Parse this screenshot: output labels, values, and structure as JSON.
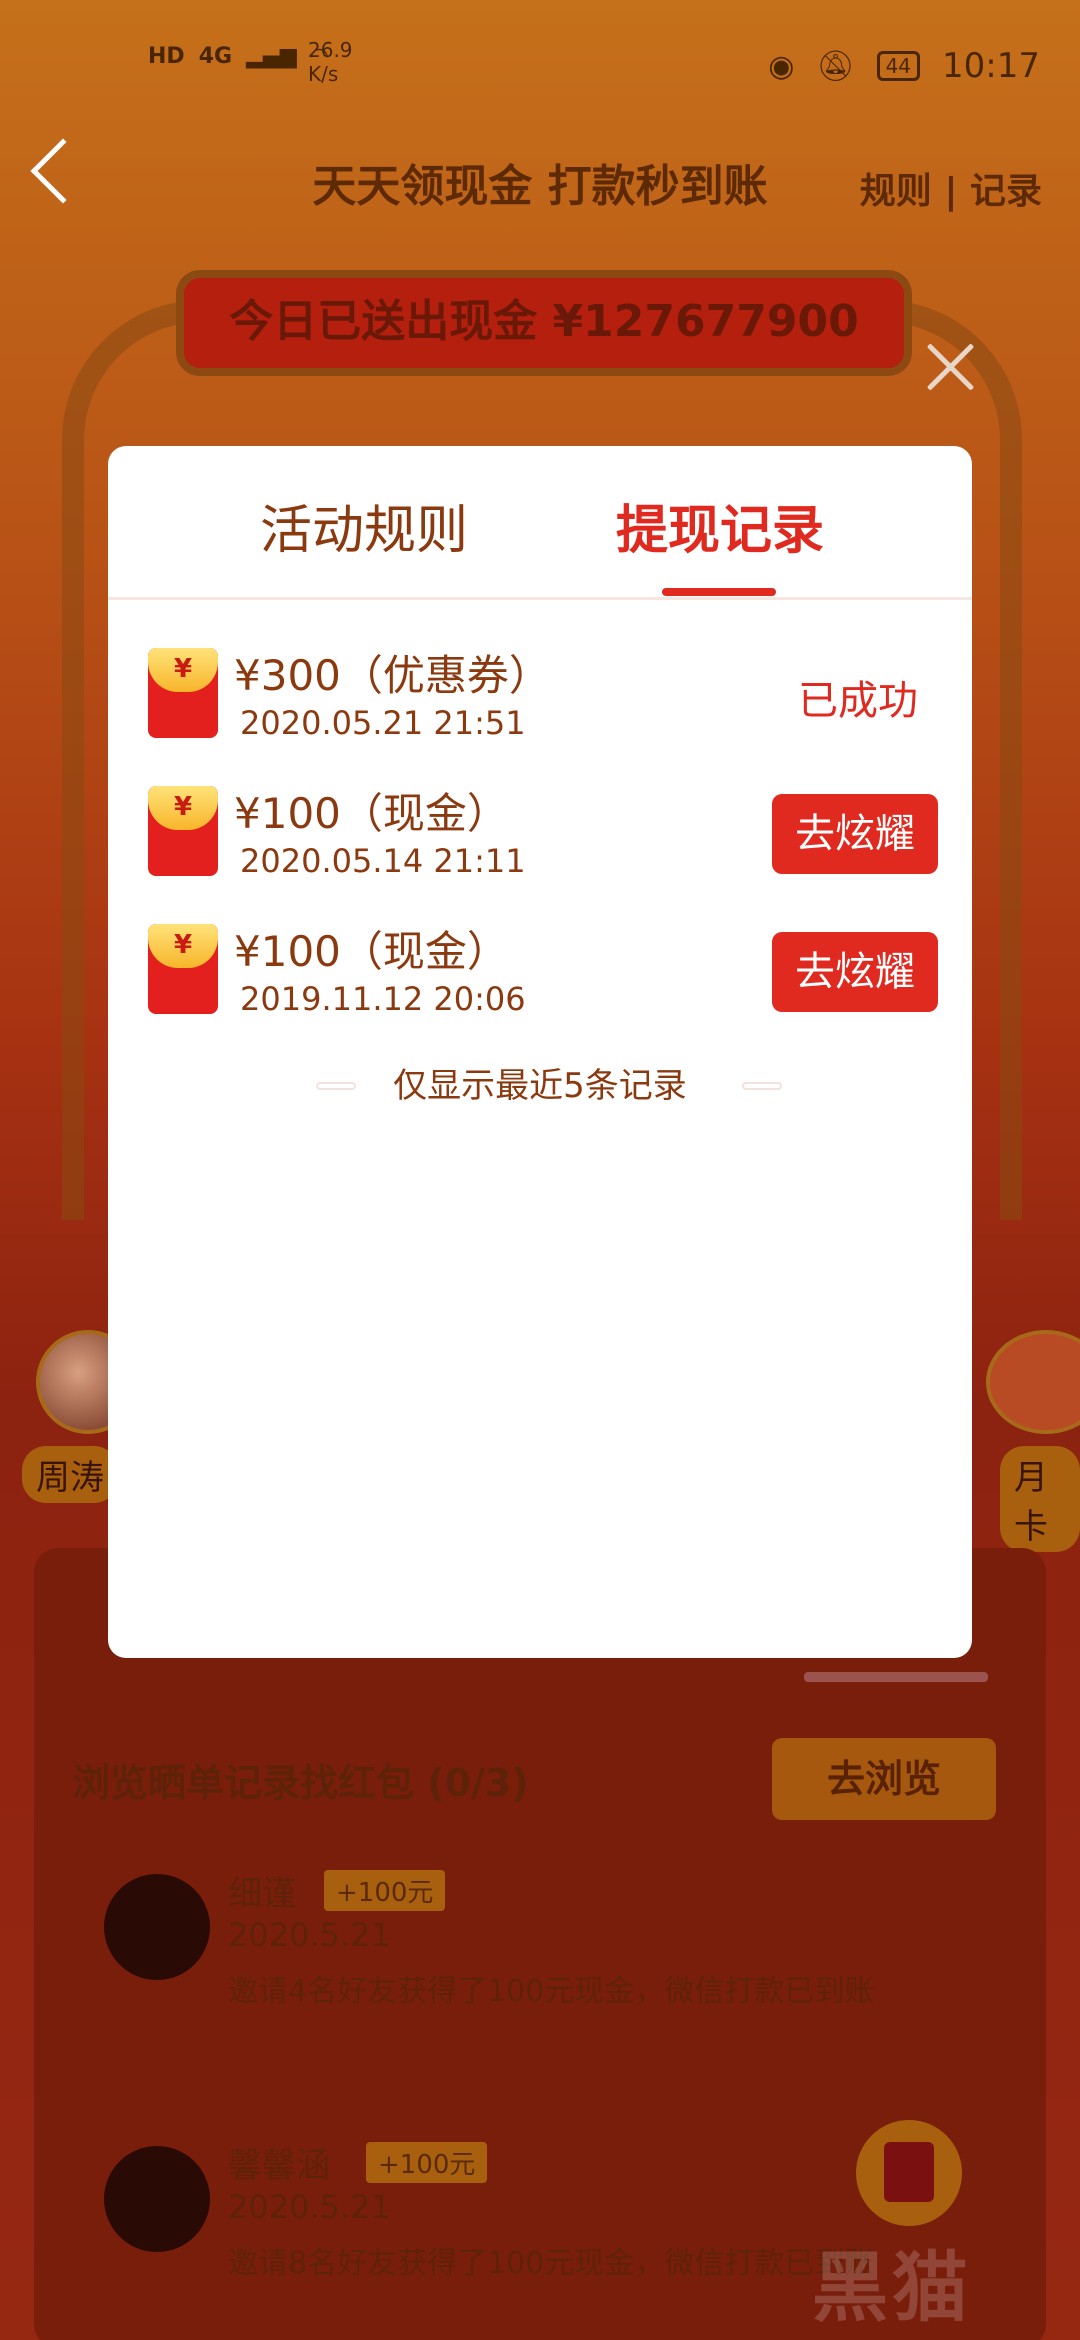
{
  "status_bar": {
    "hd": "HD",
    "net_type": "4G",
    "speed_value": "26.9",
    "speed_unit": "K/s",
    "battery": "44",
    "time": "10:17"
  },
  "header": {
    "title": "天天领现金 打款秒到账",
    "links": "规则 | 记录"
  },
  "banner": {
    "text": "今日已送出现金 ¥127677900"
  },
  "background": {
    "left_name": "周涛",
    "right_name": "月卡",
    "browse_task": "浏览晒单记录找红包 (0/3)",
    "browse_button": "去浏览",
    "feed": [
      {
        "name": "细谨",
        "badge": "+100元",
        "date": "2020.5.21",
        "text": "邀请4名好友获得了100元现金，微信打款已到账"
      },
      {
        "name": "馨馨涵",
        "badge": "+100元",
        "date": "2020.5.21",
        "text": "邀请8名好友获得了100元现金，微信打款已到账"
      }
    ],
    "watermark": "黑猫"
  },
  "modal": {
    "tabs": [
      {
        "label": "活动规则",
        "active": false
      },
      {
        "label": "提现记录",
        "active": true
      }
    ],
    "records": [
      {
        "amount": "¥300（优惠券）",
        "datetime": "2020.05.21 21:51",
        "status": "已成功"
      },
      {
        "amount": "¥100（现金）",
        "datetime": "2020.05.14 21:11",
        "action": "去炫耀"
      },
      {
        "amount": "¥100（现金）",
        "datetime": "2019.11.12 20:06",
        "action": "去炫耀"
      }
    ],
    "footer_note": "仅显示最近5条记录",
    "packet_symbol": "¥"
  },
  "colors": {
    "accent_red": "#e02a20",
    "text_brown": "#8b3a10",
    "packet_gold": "#f8b52a"
  },
  "icons": [
    "back-arrow-icon",
    "close-icon",
    "red-packet-icon",
    "eye-icon",
    "mute-icon",
    "wifi-icon",
    "signal-icon",
    "battery-icon"
  ]
}
